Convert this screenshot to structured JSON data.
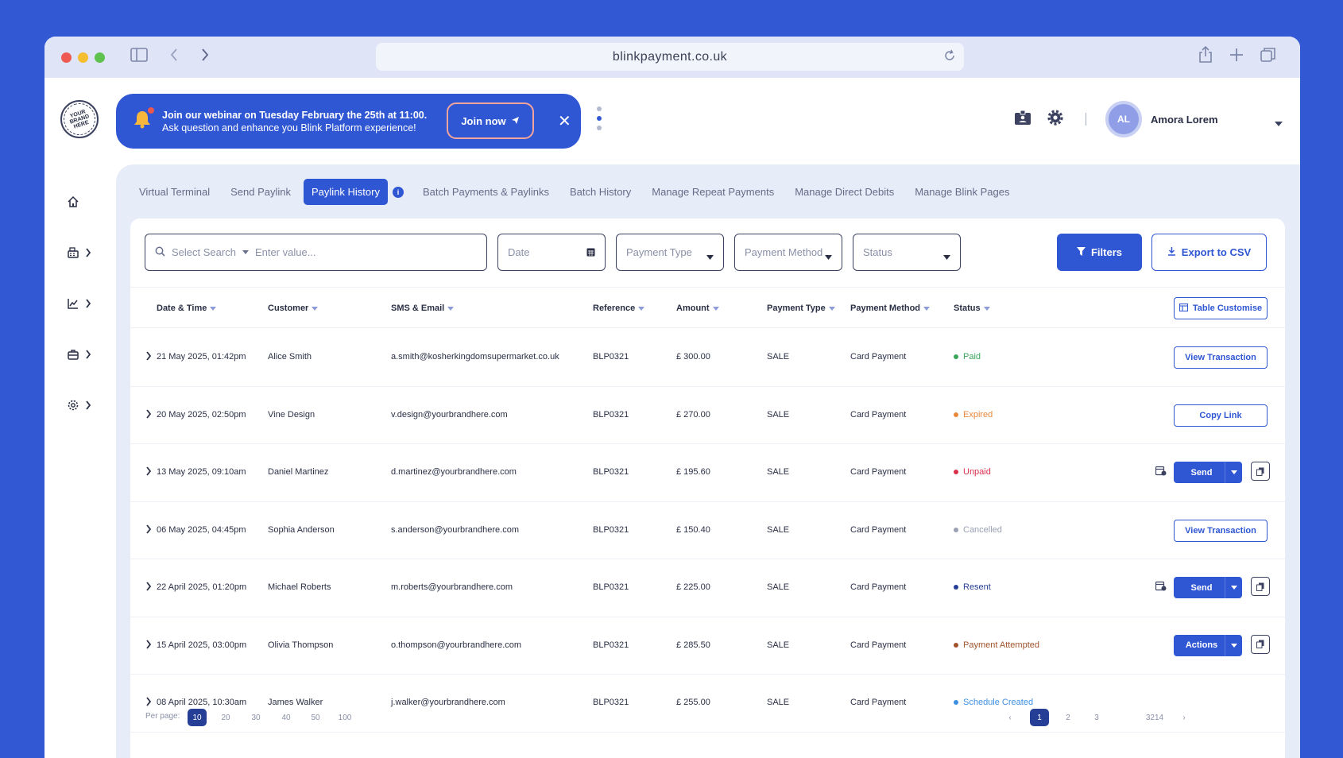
{
  "browser": {
    "url": "blinkpayment.co.uk"
  },
  "brand": {
    "logo_text": "YOUR BRAND HERE"
  },
  "banner": {
    "line1": "Join our webinar on Tuesday February the 25th at 11:00.",
    "line2": "Ask question and enhance you Blink Platform experience!",
    "join_label": "Join now"
  },
  "user": {
    "initials": "AL",
    "name": "Amora Lorem"
  },
  "tabs": [
    {
      "label": "Virtual Terminal"
    },
    {
      "label": "Send Paylink"
    },
    {
      "label": "Paylink History"
    },
    {
      "label": "Batch Payments & Paylinks"
    },
    {
      "label": "Batch History"
    },
    {
      "label": "Manage Repeat Payments"
    },
    {
      "label": "Manage Direct Debits"
    },
    {
      "label": "Manage Blink Pages"
    }
  ],
  "filters": {
    "select_search": "Select Search",
    "search_placeholder": "Enter value...",
    "date": "Date",
    "payment_type": "Payment Type",
    "payment_method": "Payment Method",
    "status": "Status",
    "filters_label": "Filters",
    "export_label": "Export to CSV"
  },
  "table": {
    "customise_label": "Table Customise",
    "headers": [
      "Date & Time",
      "Customer",
      "SMS & Email",
      "Reference",
      "Amount",
      "Payment Type",
      "Payment Method",
      "Status"
    ],
    "rows": [
      {
        "date": "21  May 2025, 01:42pm",
        "customer": "Alice Smith",
        "email": "a.smith@kosherkingdomsupermarket.co.uk",
        "ref": "BLP0321",
        "amount": "£ 300.00",
        "type": "SALE",
        "method": "Card Payment",
        "status": "Paid",
        "status_color": "#3ba55c",
        "action": "View Transaction"
      },
      {
        "date": "20 May 2025, 02:50pm",
        "customer": "Vine Design",
        "email": "v.design@yourbrandhere.com",
        "ref": "BLP0321",
        "amount": "£ 270.00",
        "type": "SALE",
        "method": "Card Payment",
        "status": "Expired",
        "status_color": "#e8883a",
        "action": "Copy Link"
      },
      {
        "date": "13 May 2025, 09:10am",
        "customer": "Daniel Martinez",
        "email": "d.martinez@yourbrandhere.com",
        "ref": "BLP0321",
        "amount": "£ 195.60",
        "type": "SALE",
        "method": "Card Payment",
        "status": "Unpaid",
        "status_color": "#d9304c",
        "action": "Send"
      },
      {
        "date": "06 May 2025, 04:45pm",
        "customer": "Sophia Anderson",
        "email": "s.anderson@yourbrandhere.com",
        "ref": "BLP0321",
        "amount": "£ 150.40",
        "type": "SALE",
        "method": "Card Payment",
        "status": "Cancelled",
        "status_color": "#9aa0b3",
        "action": "View Transaction"
      },
      {
        "date": "22 April 2025, 01:20pm",
        "customer": "Michael Roberts",
        "email": "m.roberts@yourbrandhere.com",
        "ref": "BLP0321",
        "amount": "£ 225.00",
        "type": "SALE",
        "method": "Card Payment",
        "status": "Resent",
        "status_color": "#253f96",
        "action": "Send"
      },
      {
        "date": "15 April 2025, 03:00pm",
        "customer": "Olivia Thompson",
        "email": "o.thompson@yourbrandhere.com",
        "ref": "BLP0321",
        "amount": "£ 285.50",
        "type": "SALE",
        "method": "Card Payment",
        "status": "Payment Attempted",
        "status_color": "#a0522d",
        "action": "Actions"
      },
      {
        "date": "08 April 2025, 10:30am",
        "customer": "James Walker",
        "email": "j.walker@yourbrandhere.com",
        "ref": "BLP0321",
        "amount": "£ 255.00",
        "type": "SALE",
        "method": "Card Payment",
        "status": "Schedule Created",
        "status_color": "#3d8fe0",
        "action": ""
      }
    ]
  },
  "pagination": {
    "per_page_label": "Per page:",
    "per_page_options": [
      "10",
      "20",
      "30",
      "40",
      "50",
      "100"
    ],
    "pages": [
      "1",
      "2",
      "3",
      "3214"
    ]
  },
  "colors": {
    "accent": "#2f56d3",
    "background": "#3358D4",
    "panel": "#e7ecf9"
  }
}
